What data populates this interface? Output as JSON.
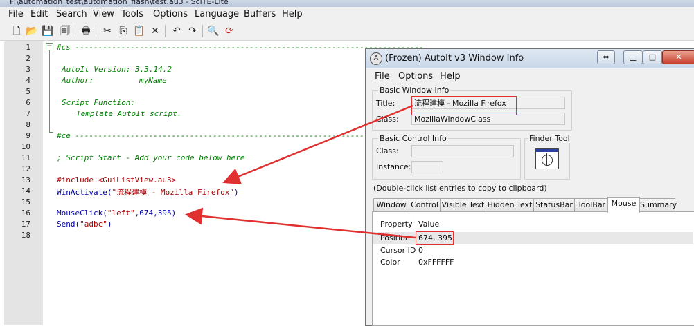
{
  "editor": {
    "title": "F:\\automation_test\\automation_flash\\test.au3 - SciTE-Lite",
    "menu": [
      "File",
      "Edit",
      "Search",
      "View",
      "Tools",
      "Options",
      "Language",
      "Buffers",
      "Help"
    ],
    "toolbar_icons": [
      "new-file-icon",
      "open-folder-icon",
      "save-icon",
      "close-file-icon",
      "print-icon",
      "cut-icon",
      "copy-icon",
      "paste-icon",
      "delete-icon",
      "undo-icon",
      "redo-icon",
      "find-icon",
      "replace-icon"
    ],
    "line_numbers": [
      "1",
      "2",
      "3",
      "4",
      "5",
      "6",
      "7",
      "8",
      "9",
      "10",
      "11",
      "12",
      "13",
      "14",
      "15",
      "16",
      "17",
      "18"
    ],
    "code": {
      "l1": "#cs ----------------------------------------------------------------------------",
      "l3": "AutoIt Version: 3.3.14.2",
      "l4_a": "Author:",
      "l4_b": "myName",
      "l6": "Script Function:",
      "l7": "Template AutoIt script.",
      "l9": "#ce ----------------------------------------------------------------------------",
      "l11": "; Script Start - Add your code below here",
      "l13_kw": "#include",
      "l13_arg": "<GuiListView.au3>",
      "l14_fn": "WinActivate",
      "l14_open": "(",
      "l14_str": "\"流程建模 - Mozilla Firefox\"",
      "l14_close": ")",
      "l16_fn": "MouseClick",
      "l16_open": "(",
      "l16_str": "\"left\"",
      "l16_c1": ",",
      "l16_n1": "674",
      "l16_c2": ",",
      "l16_n2": "395",
      "l16_close": ")",
      "l17_fn": "Send",
      "l17_open": "(",
      "l17_str": "\"adbc\"",
      "l17_close": ")"
    }
  },
  "window_info": {
    "title": "(Frozen) AutoIt v3 Window Info",
    "menu": [
      "File",
      "Options",
      "Help"
    ],
    "basic_window": {
      "group_label": "Basic Window Info",
      "title_label": "Title:",
      "title_value": "流程建模 - Mozilla Firefox",
      "class_label": "Class:",
      "class_value": "MozillaWindowClass"
    },
    "basic_control": {
      "group_label": "Basic Control Info",
      "class_label": "Class:",
      "instance_label": "Instance:"
    },
    "finder_tool_label": "Finder Tool",
    "hint": "(Double-click list entries to copy to clipboard)",
    "tabs": [
      "Window",
      "Control",
      "Visible Text",
      "Hidden Text",
      "StatusBar",
      "ToolBar",
      "Mouse",
      "Summary"
    ],
    "active_tab": "Mouse",
    "columns": [
      "Property",
      "Value"
    ],
    "rows": [
      {
        "property": "Position",
        "value": "674, 395"
      },
      {
        "property": "Cursor ID",
        "value": "0"
      },
      {
        "property": "Color",
        "value": "0xFFFFFF"
      }
    ]
  },
  "colors": {
    "annotation_red": "#e03030",
    "comment_green": "#008000",
    "keyword_blue": "#0000aa",
    "string_red": "#aa0000"
  }
}
